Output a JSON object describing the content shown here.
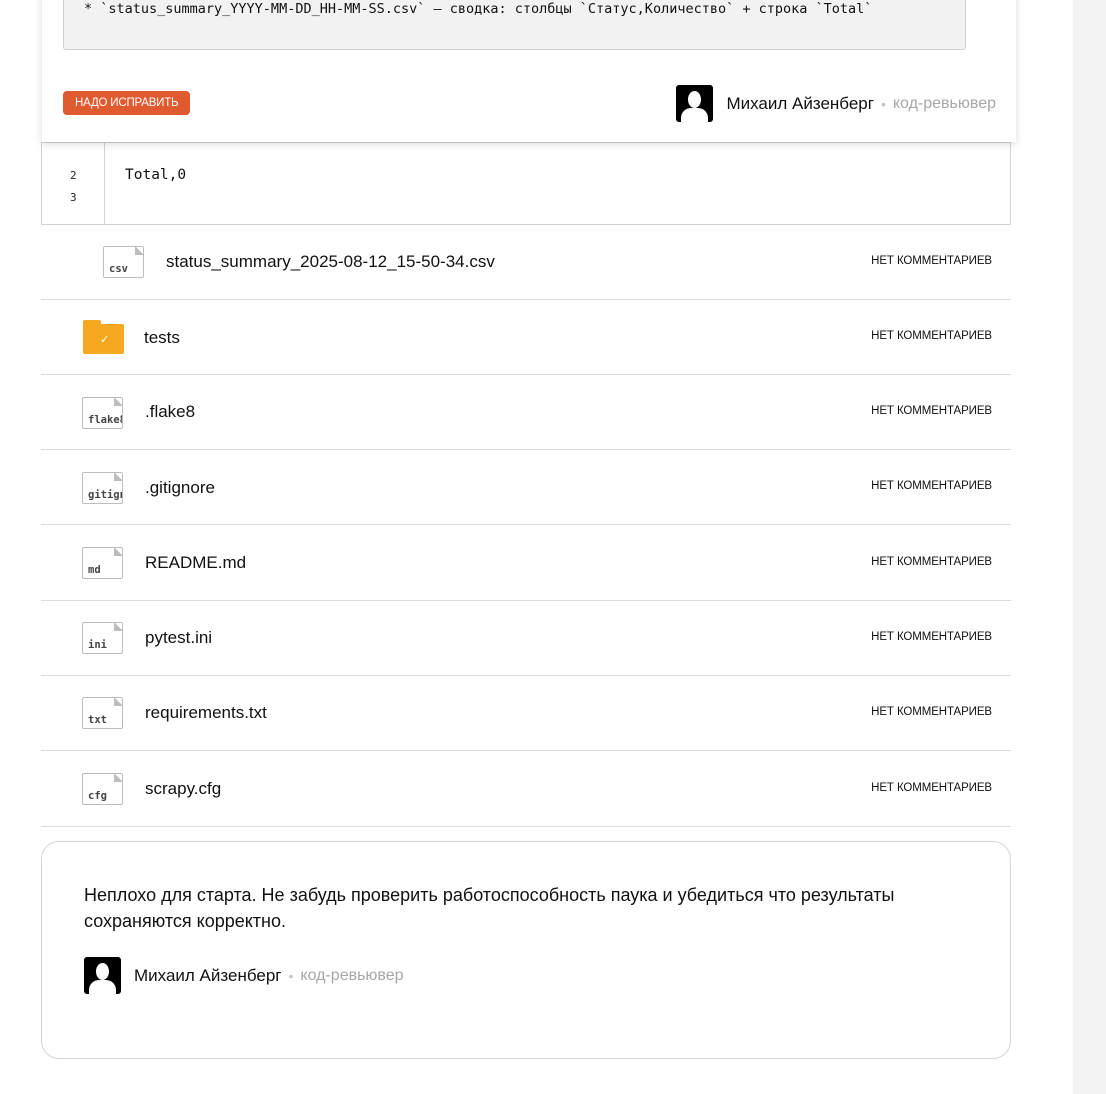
{
  "review_comment": {
    "code_text": "* `status_summary_YYYY-MM-DD_HH-MM-SS.csv` — сводка: столбцы `Статус,Количество` + строка `Total`",
    "badge": "НАДО ИСПРАВИТЬ",
    "author": {
      "name": "Михаил Айзенберг",
      "separator": "•",
      "role": "код-ревьювер"
    }
  },
  "snippet": {
    "line_numbers": [
      "2",
      "3"
    ],
    "code": "Total,0"
  },
  "files": [
    {
      "icon": "csv",
      "name": "status_summary_2025-08-12_15-50-34.csv",
      "comments": "НЕТ КОММЕНТАРИЕВ"
    },
    {
      "icon": "folder-check",
      "name": "tests",
      "comments": "НЕТ КОММЕНТАРИЕВ"
    },
    {
      "icon": "flake8",
      "name": ".flake8",
      "comments": "НЕТ КОММЕНТАРИЕВ"
    },
    {
      "icon": "gitignore",
      "name": ".gitignore",
      "comments": "НЕТ КОММЕНТАРИЕВ"
    },
    {
      "icon": "md",
      "name": "README.md",
      "comments": "НЕТ КОММЕНТАРИЕВ"
    },
    {
      "icon": "ini",
      "name": "pytest.ini",
      "comments": "НЕТ КОММЕНТАРИЕВ"
    },
    {
      "icon": "txt",
      "name": "requirements.txt",
      "comments": "НЕТ КОММЕНТАРИЕВ"
    },
    {
      "icon": "cfg",
      "name": "scrapy.cfg",
      "comments": "НЕТ КОММЕНТАРИЕВ"
    }
  ],
  "summary": {
    "text": "Неплохо для старта. Не забудь проверить работоспособность паука и убедиться что результаты сохраняются корректно.",
    "author": {
      "name": "Михаил Айзенберг",
      "separator": "•",
      "role": "код-ревьювер"
    }
  },
  "colors": {
    "badge": "#e05a2f",
    "folder": "#f3a81f"
  }
}
